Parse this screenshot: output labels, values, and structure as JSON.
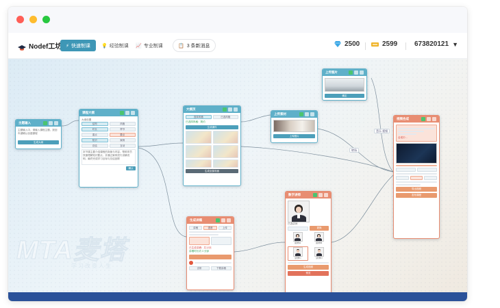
{
  "window": {
    "controls": [
      {
        "name": "close",
        "color": "#ff5f57"
      },
      {
        "name": "minimize",
        "color": "#febc2e"
      },
      {
        "name": "maximize",
        "color": "#28c840"
      }
    ]
  },
  "navbar": {
    "app_name": "Nodef工坊",
    "modes": [
      {
        "label": "快速制课",
        "active": true,
        "icon": "bolt-icon"
      },
      {
        "label": "经验制课",
        "active": false,
        "icon": "bulb-icon"
      },
      {
        "label": "专业制课",
        "active": false,
        "icon": "chart-icon"
      }
    ],
    "notice": "3 条新消息",
    "diamonds": "2500",
    "coins": "2599",
    "user_id": "673820121",
    "user_menu_icon": "caret-down-icon"
  },
  "canvas": {
    "watermark_big": "MTA麦塔",
    "watermark_small": "学习改变人生"
  },
  "edges": [
    {
      "label": "转场"
    },
    {
      "label": "音乐 视频"
    }
  ],
  "nodes": {
    "n1": {
      "title": "主题输入",
      "text": "主题输入中，请输入课程主题，按回车键确认创建课程",
      "button": "生成大纲"
    },
    "n2": {
      "title": "课程大纲",
      "section": "大纲设置",
      "chips": [
        "结构",
        "风格",
        "时长",
        "章节",
        "重点",
        "要点",
        "知识",
        "案例",
        "总结",
        "互动"
      ],
      "text": "本节课主要介绍课程的背景与内容，帮助学员快速理解知识要点，并通过案例进行讲解说明，最终完成学习目标与总结回顾",
      "button": "确认"
    },
    "n3": {
      "title": "大纲页",
      "tabs": [
        "选择风格",
        "已选风格"
      ],
      "status": "已选择风格：简约",
      "button": "生成课件",
      "footer": "生成全部页面"
    },
    "n4": {
      "title": "上传素材",
      "button": "上传图片"
    },
    "n5": {
      "title": "上传图片",
      "button": "确定"
    },
    "n6": {
      "title": "生成讲稿",
      "tabs": [
        "讲稿",
        "语音",
        "上传"
      ],
      "status": [
        "已生成讲稿：共12页",
        "讲稿时长约 3 分钟"
      ],
      "buttons": [
        "试听",
        "下载讲稿"
      ]
    },
    "n7": {
      "title": "数字讲师",
      "label": "已选讲师",
      "button": "更换",
      "avatars": [
        "讲师A",
        "讲师B",
        "讲师C",
        "讲师D"
      ],
      "buttons": [
        "生成视频",
        "预览"
      ]
    },
    "n8": {
      "title": "视频合成",
      "status": "合成中...",
      "buttons": [
        "导出视频",
        "发布课程"
      ]
    }
  }
}
